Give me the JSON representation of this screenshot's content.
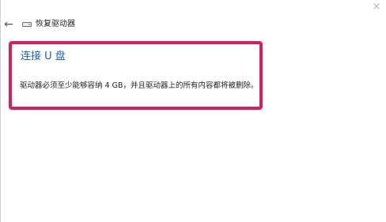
{
  "window": {
    "close_glyph": "×",
    "back_glyph": "←",
    "title": "恢复驱动器"
  },
  "content": {
    "heading": "连接 U 盘",
    "message": "驱动器必须至少能够容纳 4 GB，并且驱动器上的所有内容都将被删除。"
  },
  "colors": {
    "highlight_border": "#d71f5a",
    "heading": "#1a5fb4"
  },
  "icons": {
    "back": "back-arrow-icon",
    "drive": "drive-icon",
    "close": "close-icon"
  }
}
